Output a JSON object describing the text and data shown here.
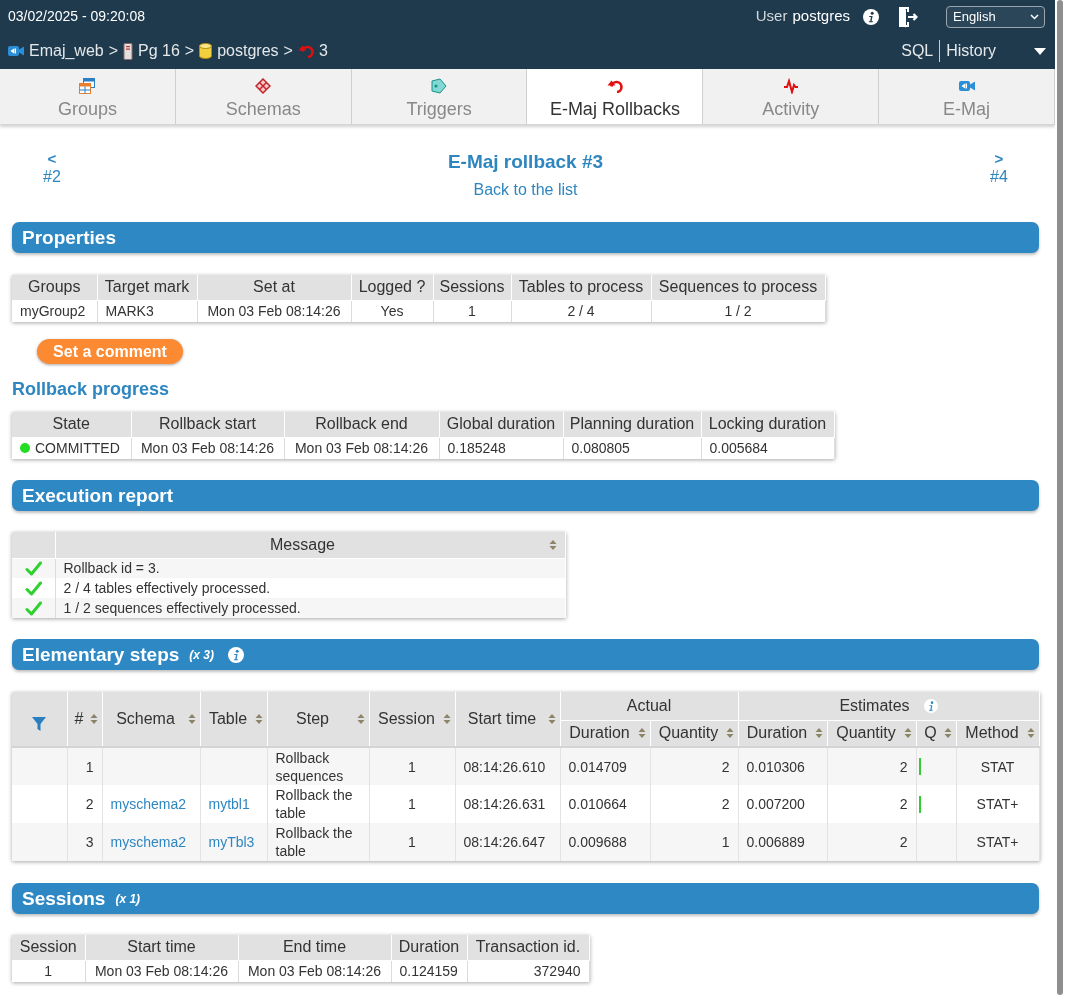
{
  "header": {
    "datetime": "03/02/2025 - 09:20:08",
    "user_label": "User",
    "user_name": "postgres",
    "language": "English"
  },
  "breadcrumb": [
    {
      "kind": "instance",
      "label": "Emaj_web",
      "separator": ">"
    },
    {
      "kind": "server",
      "label": "Pg 16",
      "separator": ">"
    },
    {
      "kind": "database",
      "label": "postgres",
      "separator": ">"
    },
    {
      "kind": "rollback",
      "label": "3"
    }
  ],
  "top_links": [
    "SQL",
    "History"
  ],
  "tabs": [
    {
      "kind": "groups",
      "label": "Groups",
      "selected": false
    },
    {
      "kind": "schemas",
      "label": "Schemas",
      "selected": false
    },
    {
      "kind": "triggers",
      "label": "Triggers",
      "selected": false
    },
    {
      "kind": "rollbacks",
      "label": "E-Maj Rollbacks",
      "selected": true
    },
    {
      "kind": "activity",
      "label": "Activity",
      "selected": false
    },
    {
      "kind": "emaj",
      "label": "E-Maj",
      "selected": false
    }
  ],
  "navigation": {
    "previous": {
      "arrow": "<",
      "label": "#2"
    },
    "title": "E-Maj rollback #3",
    "back_link": "Back to the list",
    "next": {
      "arrow": ">",
      "label": "#4"
    }
  },
  "properties": {
    "title": "Properties",
    "columns": [
      "Groups",
      "Target mark",
      "Set at",
      "Logged ?",
      "Sessions",
      "Tables to process",
      "Sequences to process"
    ],
    "rows": [
      [
        "myGroup2",
        "MARK3",
        "Mon 03 Feb 08:14:26",
        "Yes",
        "1",
        "2 / 4",
        "1 / 2"
      ]
    ],
    "comment_button": "Set a comment"
  },
  "rollback_progress": {
    "title": "Rollback progress",
    "columns": [
      "State",
      "Rollback start",
      "Rollback end",
      "Global duration",
      "Planning duration",
      "Locking duration"
    ],
    "rows": [
      {
        "state": "COMMITTED",
        "color": "#22dd22",
        "rollback_start": "Mon 03 Feb 08:14:26",
        "rollback_end": "Mon 03 Feb 08:14:26",
        "global_duration": "0.185248",
        "planning_duration": "0.080805",
        "locking_duration": "0.005684"
      }
    ]
  },
  "execution_report": {
    "title": "Execution report",
    "columns": [
      {
        "label": "Message",
        "sortable": true
      }
    ],
    "rows": [
      {
        "message": "Rollback id = 3."
      },
      {
        "message": "2 / 4 tables effectively processed."
      },
      {
        "message": "1 / 2 sequences effectively processed."
      }
    ]
  },
  "elementary_steps": {
    "title": "Elementary steps",
    "count": "(x 3)",
    "info": true,
    "columns": [
      {
        "label": "#",
        "sortable": true
      },
      {
        "label": "Schema",
        "sortable": true
      },
      {
        "label": "Table",
        "sortable": true
      },
      {
        "label": "Step",
        "sortable": true
      },
      {
        "label": "Session",
        "sortable": true
      },
      {
        "label": "Start time",
        "sortable": true
      },
      {
        "label": "Actual",
        "children": [
          {
            "label": "Duration",
            "sortable": true
          },
          {
            "label": "Quantity",
            "sortable": true
          }
        ]
      },
      {
        "label": "Estimates",
        "info": true,
        "children": [
          {
            "label": "Duration",
            "sortable": true
          },
          {
            "label": "Quantity",
            "sortable": true
          },
          {
            "label": "Q",
            "sortable": true
          },
          {
            "label": "Method",
            "sortable": true
          }
        ]
      }
    ],
    "rows": [
      {
        "number": "1",
        "step": "Rollback sequences",
        "session": "1",
        "start_time": "08:14:26.610",
        "actual_duration": "0.014709",
        "actual_quantity": "2",
        "estimated_duration": "0.010306",
        "estimated_quantity": "2",
        "q_indicator": true,
        "method": "STAT"
      },
      {
        "number": "2",
        "schema": "myschema2",
        "table": "mytbl1",
        "step": "Rollback the table",
        "session": "1",
        "start_time": "08:14:26.631",
        "actual_duration": "0.010664",
        "actual_quantity": "2",
        "estimated_duration": "0.007200",
        "estimated_quantity": "2",
        "q_indicator": true,
        "method": "STAT+"
      },
      {
        "number": "3",
        "schema": "myschema2",
        "table": "myTbl3",
        "step": "Rollback the table",
        "session": "1",
        "start_time": "08:14:26.647",
        "actual_duration": "0.009688",
        "actual_quantity": "1",
        "estimated_duration": "0.006889",
        "estimated_quantity": "2",
        "q_indicator": false,
        "method": "STAT+"
      }
    ]
  },
  "sessions": {
    "title": "Sessions",
    "count": "(x 1)",
    "columns": [
      "Session",
      "Start time",
      "End time",
      "Duration",
      "Transaction id."
    ],
    "rows": [
      [
        "1",
        "Mon 03 Feb 08:14:26",
        "Mon 03 Feb 08:14:26",
        "0.124159",
        "372940"
      ]
    ]
  }
}
